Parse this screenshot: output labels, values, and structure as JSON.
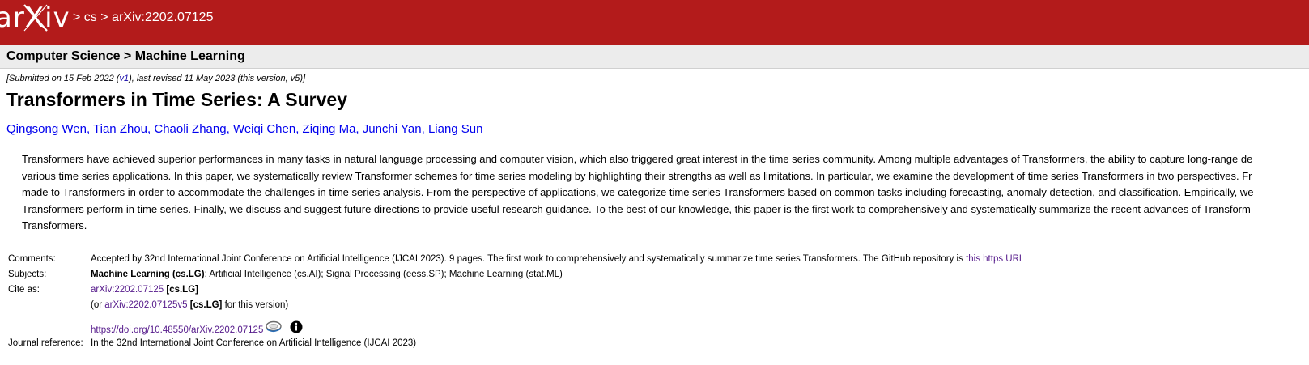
{
  "header": {
    "logo_text": "arXiv",
    "breadcrumb": [
      {
        "sep": ">",
        "label": "cs"
      },
      {
        "sep": ">",
        "label": "arXiv:2202.07125"
      }
    ],
    "background_color": "#b31b1b"
  },
  "subheader": {
    "title": "Computer Science > Machine Learning"
  },
  "dateline": {
    "prefix": "[Submitted on 15 Feb 2022 (",
    "v1_link": "v1",
    "suffix": "), last revised 11 May 2023 (this version, v5)]"
  },
  "paper": {
    "title": "Transformers in Time Series: A Survey",
    "authors": [
      "Qingsong Wen",
      "Tian Zhou",
      "Chaoli Zhang",
      "Weiqi Chen",
      "Ziqing Ma",
      "Junchi Yan",
      "Liang Sun"
    ],
    "author_separator": ",",
    "abstract_lines": [
      "Transformers have achieved superior performances in many tasks in natural language processing and computer vision, which also triggered great interest in the time series community. Among multiple advantages of Transformers, the ability to capture long-range de",
      "various time series applications. In this paper, we systematically review Transformer schemes for time series modeling by highlighting their strengths as well as limitations. In particular, we examine the development of time series Transformers in two perspectives. Fr",
      "made to Transformers in order to accommodate the challenges in time series analysis. From the perspective of applications, we categorize time series Transformers based on common tasks including forecasting, anomaly detection, and classification. Empirically, we",
      "Transformers perform in time series. Finally, we discuss and suggest future directions to provide useful research guidance. To the best of our knowledge, this paper is the first work to comprehensively and systematically summarize the recent advances of Transform",
      "Transformers."
    ]
  },
  "metadata": {
    "comments": {
      "label": "Comments:",
      "text": "Accepted by 32nd International Joint Conference on Artificial Intelligence (IJCAI 2023). 9 pages. The first work to comprehensively and systematically summarize time series Transformers. The GitHub repository is ",
      "link": "this https URL"
    },
    "subjects": {
      "label": "Subjects:",
      "primary": "Machine Learning (cs.LG)",
      "rest": "; Artificial Intelligence (cs.AI); Signal Processing (eess.SP); Machine Learning (stat.ML)"
    },
    "cite_as": {
      "label": "Cite as:",
      "id_link": "arXiv:2202.07125",
      "id_tag": "[cs.LG]",
      "version_prefix": "(or ",
      "version_link": "arXiv:2202.07125v5",
      "version_tag": "[cs.LG]",
      "version_suffix": " for this version)",
      "doi": "https://doi.org/10.48550/arXiv.2202.07125"
    },
    "journal_ref": {
      "label": "Journal reference:",
      "text": "In the 32nd International Joint Conference on Artificial Intelligence (IJCAI 2023)"
    }
  },
  "icons": {
    "doi_icons": [
      "datacite-icon",
      "info-icon"
    ]
  }
}
